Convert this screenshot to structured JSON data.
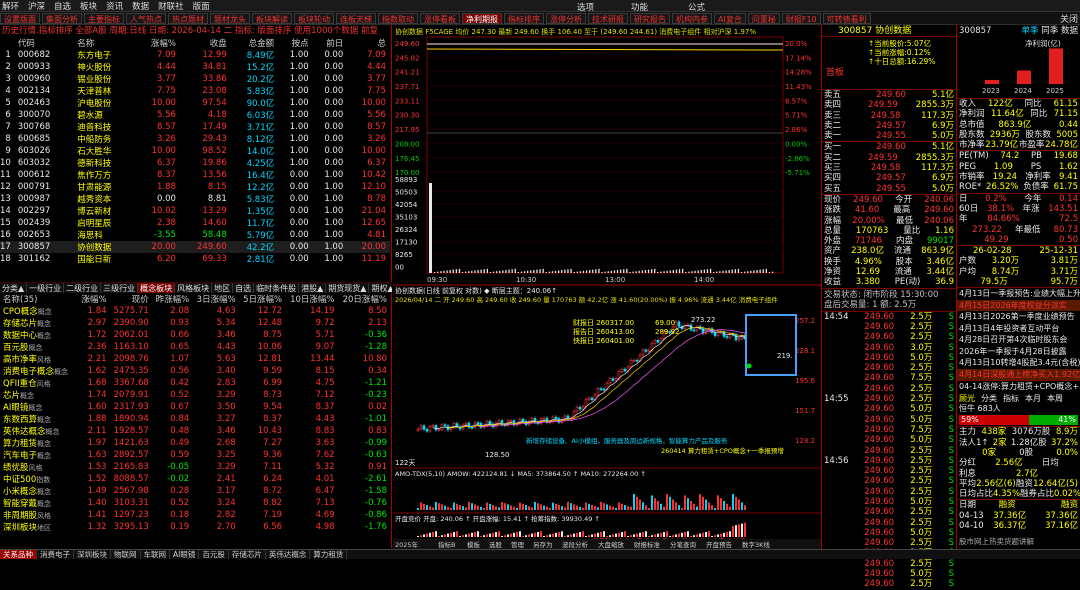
{
  "menubar": {
    "items": [
      "解环",
      "沪深",
      "自选",
      "板块",
      "资讯",
      "数据",
      "财联社",
      "版面"
    ],
    "center": "选项",
    "center2": "功能",
    "center3": "公式"
  },
  "toolbar": {
    "items": [
      "设置版面",
      "集面分析",
      "主要指标",
      "人气热点",
      "热点题材",
      "题材龙头",
      "板块解读",
      "板块轮动",
      "连板天梯",
      "指数取动",
      "涨停看板",
      "净利期报",
      "指标排序",
      "涨停分析",
      "技术研报",
      "研究报告",
      "机构内参",
      "AI复合",
      "问董秘",
      "财报F10",
      "可转债看利"
    ],
    "active": 11,
    "close": "关闭"
  },
  "left": {
    "title": "历史行情.指标排序 全部A股 周期:日线 日期: 2026-04-14 二 指标: 版面排序 使用1000个数据 前复",
    "headers": [
      "代码",
      "名称",
      "涨幅%",
      "收盘",
      "总金额",
      "按点",
      "前日",
      "总"
    ],
    "rows": [
      [
        "1",
        "000682",
        "东方电子",
        "7.09",
        "12.99",
        "8.49亿",
        "1.00",
        "0.00",
        "7.09"
      ],
      [
        "2",
        "000933",
        "神火股份",
        "4.44",
        "34.81",
        "15.2亿",
        "1.00",
        "0.00",
        "4.44"
      ],
      [
        "3",
        "000960",
        "锡业股份",
        "3.77",
        "33.86",
        "20.2亿",
        "1.00",
        "0.00",
        "3.77"
      ],
      [
        "4",
        "002134",
        "天津普林",
        "7.75",
        "23.08",
        "5.83亿",
        "1.00",
        "0.00",
        "7.75"
      ],
      [
        "5",
        "002463",
        "沪电股份",
        "10.00",
        "97.54",
        "90.0亿",
        "1.00",
        "0.00",
        "10.00"
      ],
      [
        "6",
        "300070",
        "碧水源",
        "5.56",
        "4.18",
        "6.03亿",
        "1.00",
        "0.00",
        "5.56"
      ],
      [
        "7",
        "300768",
        "迪普科技",
        "8.57",
        "17.49",
        "3.71亿",
        "1.00",
        "0.00",
        "8.57"
      ],
      [
        "8",
        "600685",
        "中船防务",
        "3.26",
        "29.43",
        "8.12亿",
        "1.00",
        "0.00",
        "3.26"
      ],
      [
        "9",
        "603026",
        "石大胜华",
        "10.00",
        "98.52",
        "14.0亿",
        "1.00",
        "0.00",
        "10.00"
      ],
      [
        "10",
        "603032",
        "德新科技",
        "6.37",
        "19.86",
        "4.25亿",
        "1.00",
        "0.00",
        "6.37"
      ],
      [
        "11",
        "000612",
        "焦作万方",
        "8.37",
        "13.56",
        "16.4亿",
        "0.00",
        "1.00",
        "10.42"
      ],
      [
        "12",
        "000791",
        "甘肃能源",
        "1.88",
        "8.15",
        "12.2亿",
        "0.00",
        "1.00",
        "12.10"
      ],
      [
        "13",
        "000987",
        "越秀资本",
        "0.00",
        "8.81",
        "5.83亿",
        "0.00",
        "1.00",
        "8.78"
      ],
      [
        "14",
        "002297",
        "博云新材",
        "10.02",
        "13.29",
        "1.35亿",
        "0.00",
        "1.00",
        "21.04"
      ],
      [
        "15",
        "002439",
        "启明星辰",
        "2.38",
        "14.60",
        "11.7亿",
        "0.00",
        "1.00",
        "12.65"
      ],
      [
        "16",
        "002653",
        "海思科",
        "-3.55",
        "58.48",
        "5.79亿",
        "0.00",
        "1.00",
        "4.81"
      ],
      [
        "17",
        "300857",
        "协创数据",
        "20.00",
        "249.60",
        "42.2亿",
        "0.00",
        "1.00",
        "20.00"
      ],
      [
        "18",
        "301162",
        "国能日新",
        "6.20",
        "69.33",
        "2.81亿",
        "0.00",
        "1.00",
        "11.19"
      ]
    ],
    "tabs": [
      "分类▲",
      "一级行业",
      "二级行业",
      "三级行业",
      "概念板块",
      "风格板块",
      "地区",
      "自选",
      "临时条件股",
      "港股▲",
      "期货现货▲",
      "期权▲"
    ],
    "tabs_active": 4,
    "headers2": [
      "名称(35)",
      "涨幅%",
      "现价",
      "昨涨幅%",
      "3日涨幅%",
      "5日涨幅%",
      "10日涨幅%",
      "20日涨幅%"
    ],
    "rows2": [
      [
        "CPO概念",
        "概念",
        "1.84",
        "5275.71",
        "2.08",
        "4.63",
        "12.72",
        "14.19",
        "8.50"
      ],
      [
        "存储芯片",
        "概念",
        "2.97",
        "2390.90",
        "0.93",
        "5.34",
        "12.48",
        "9.72",
        "2.13"
      ],
      [
        "数据中心",
        "概念",
        "1.72",
        "2062.01",
        "0.66",
        "3.46",
        "8.75",
        "5.71",
        "-0.36"
      ],
      [
        "百元股",
        "概念",
        "2.36",
        "1163.10",
        "0.65",
        "4.43",
        "10.06",
        "9.07",
        "-1.28"
      ],
      [
        "高市净率",
        "风格",
        "2.21",
        "2098.76",
        "1.07",
        "5.63",
        "12.81",
        "13.44",
        "10.80"
      ],
      [
        "消费电子概念",
        "概念",
        "1.62",
        "2475.35",
        "0.56",
        "3.40",
        "9.59",
        "8.15",
        "0.34"
      ],
      [
        "QFII重仓",
        "风格",
        "1.68",
        "3367.68",
        "0.42",
        "2.83",
        "6.99",
        "4.75",
        "-1.21"
      ],
      [
        "芯片",
        "概念",
        "1.74",
        "2079.91",
        "0.52",
        "3.29",
        "8.73",
        "7.12",
        "-0.23"
      ],
      [
        "AI眼镜",
        "概念",
        "1.60",
        "2317.93",
        "0.67",
        "3.50",
        "9.54",
        "8.37",
        "0.02"
      ],
      [
        "东数西算",
        "概念",
        "1.88",
        "1890.94",
        "0.84",
        "3.27",
        "8.37",
        "4.43",
        "-1.01"
      ],
      [
        "英伟达概念",
        "概念",
        "2.11",
        "1928.57",
        "0.48",
        "3.46",
        "10.43",
        "8.83",
        "0.83"
      ],
      [
        "算力租赁",
        "概念",
        "1.97",
        "1421.63",
        "0.49",
        "2.68",
        "7.27",
        "3.63",
        "-0.99"
      ],
      [
        "汽车电子",
        "概念",
        "1.63",
        "2892.57",
        "0.59",
        "3.25",
        "9.36",
        "7.62",
        "-0.63"
      ],
      [
        "绩优股",
        "风格",
        "1.53",
        "2165.83",
        "-0.05",
        "3.29",
        "7.11",
        "5.32",
        "0.91"
      ],
      [
        "中证500",
        "指数",
        "1.52",
        "8088.57",
        "-0.02",
        "2.41",
        "6.24",
        "4.01",
        "-2.61"
      ],
      [
        "小米概念",
        "概念",
        "1.49",
        "2567.98",
        "0.28",
        "3.17",
        "8.72",
        "6.47",
        "-1.58"
      ],
      [
        "智能穿戴",
        "概念",
        "1.40",
        "3103.31",
        "0.52",
        "3.24",
        "8.82",
        "7.13",
        "-0.76"
      ],
      [
        "非周期股",
        "风格",
        "1.41",
        "1297.23",
        "0.18",
        "2.82",
        "7.19",
        "4.69",
        "-0.86"
      ],
      [
        "深圳板块",
        "地区",
        "1.32",
        "3295.13",
        "0.19",
        "2.70",
        "6.56",
        "4.98",
        "-1.76"
      ]
    ]
  },
  "bottom_tabs": [
    "关系品种",
    "消费电子",
    "深圳板块",
    "物联网",
    "车联网",
    "AI眼镜",
    "百元股",
    "存储芯片",
    "英伟达概念",
    "算力租赁"
  ],
  "center": {
    "minute_header": "协创数据 F5CAGE 均价 247.30 最新 249.60 换手 106.40 至于 (249.60 244.61) 消费电子组件 相对沪深 1.97%",
    "price_labels": [
      "249.60",
      "245.82",
      "241.21",
      "237.71",
      "233.11",
      "230.30",
      "217.95",
      "208.00",
      "176.45",
      "170.00"
    ],
    "pct_labels": [
      "20.0%",
      "17.14%",
      "14.28%",
      "11.43%",
      "8.57%",
      "5.71%",
      "2.86%",
      "0.00%",
      "-2.86%",
      "-5.71%"
    ],
    "vol_labels": [
      "58893",
      "50503",
      "42054",
      "35103",
      "26324",
      "17130",
      "8265",
      "00"
    ],
    "time_labels": [
      "09:30",
      "10:30",
      "13:00",
      "14:00"
    ],
    "kline_header": "协创数据(日线 前复权 对数) ◆ 断层主题：240.06↑",
    "kline_sub": "2026/04/14 二 开 249.60 高 249.60 收 249.60 量 170763 额 42.2亿 涨 41.60(20.00%) 振 4.96% 流通 3.44亿 消费电子组件",
    "info_box": [
      "财报日 260317.00",
      "报告日 260413.00",
      "快报日 260401.00"
    ],
    "info_vals": [
      "69.00",
      "289.92",
      ""
    ],
    "kline_price": [
      "257.2",
      "228.1",
      "195.6",
      "151.7",
      "128.2"
    ],
    "annot_low": "128.50",
    "annot_high": "273.22",
    "annot_right": "219.",
    "days": "122天",
    "news": "新增存储设备、AI小模组，服务器及周边新规格，智能算力产品及服务",
    "news2": "260414 算力租赁+CPO概念+一季报预增",
    "macd_header": "AMO-TDX(5,10) AMOW: 422124.81 ↓ MA5: 373864.50 ↑ MA10: 272264.00 ↑",
    "ind_header": "开盘竞价 开盘: 240.06 ↑ 开盘涨幅: 15.41 ↑ 抢筹指数: 39930.49 ↑",
    "bottom_labels": [
      "2025年",
      "指标B",
      "模板",
      "选股",
      "管理",
      "另存为",
      "波段分析",
      "大盘缩放",
      "财报标准",
      "分笔查询",
      "开盘预告",
      "数字3K线"
    ],
    "bottom_info": "卖单数: 19.0 上市: 2089天 主力买入: 19.0 上市: 249天"
  },
  "quote": {
    "code": "300857",
    "name": "协创数据",
    "badge": "首板",
    "tags": [
      "↑当前股价:5.07亿",
      "↑当前涨幅:0.12%",
      "↑十日总额:16.29%"
    ],
    "sells": [
      [
        "卖五",
        "249.60",
        "5.1亿"
      ],
      [
        "卖四",
        "249.59",
        "2855.3万"
      ],
      [
        "卖三",
        "249.58",
        "117.3万"
      ],
      [
        "卖二",
        "249.57",
        "6.9万"
      ],
      [
        "卖一",
        "249.55",
        "5.0万"
      ]
    ],
    "buys": [
      [
        "买一",
        "249.60",
        "5.1亿"
      ],
      [
        "买二",
        "249.59",
        "2855.3万"
      ],
      [
        "买三",
        "249.58",
        "117.3万"
      ],
      [
        "买四",
        "249.57",
        "6.9万"
      ],
      [
        "买五",
        "249.55",
        "5.0万"
      ]
    ],
    "stats": [
      [
        "现价",
        "249.60",
        "今开",
        "240.06"
      ],
      [
        "涨跌",
        "41.60",
        "最高",
        "249.60"
      ],
      [
        "涨幅",
        "20.00%",
        "最低",
        "240.06"
      ],
      [
        "总量",
        "170763",
        "量比",
        "1.16"
      ],
      [
        "外盘",
        "71746",
        "内盘",
        "99017"
      ],
      [
        "资产",
        "238.0亿",
        "流通",
        "863.9亿"
      ],
      [
        "换手",
        "4.96%",
        "股本",
        "3.46亿"
      ],
      [
        "净资",
        "12.69",
        "流通",
        "3.44亿"
      ],
      [
        "收益",
        "3.380",
        "PE(动)",
        "36.9"
      ]
    ],
    "session": "交易状态: 闭市阶段 15:30:00",
    "after": "盘后交易量: 1 额: 2.5万",
    "ticks": [
      [
        "14:54",
        "249.60",
        "2.5万",
        "S"
      ],
      [
        "",
        "249.60",
        "2.5万",
        "S"
      ],
      [
        "",
        "249.60",
        "2.5万",
        "S"
      ],
      [
        "",
        "249.60",
        "3.0万",
        "S"
      ],
      [
        "",
        "249.60",
        "5.0万",
        "S"
      ],
      [
        "",
        "249.60",
        "2.5万",
        "S"
      ],
      [
        "",
        "249.60",
        "7.5万",
        "S"
      ],
      [
        "",
        "249.60",
        "2.5万",
        "S"
      ],
      [
        "14:55",
        "249.60",
        "2.5万",
        "S"
      ],
      [
        "",
        "249.60",
        "5.0万",
        "S"
      ],
      [
        "",
        "249.60",
        "5.0万",
        "S"
      ],
      [
        "",
        "249.60",
        "7.5万",
        "S"
      ],
      [
        "",
        "249.60",
        "5.0万",
        "S"
      ],
      [
        "",
        "249.60",
        "2.5万",
        "S"
      ],
      [
        "14:56",
        "249.60",
        "2.5万",
        "S"
      ],
      [
        "",
        "249.60",
        "2.5万",
        "S"
      ],
      [
        "",
        "249.60",
        "2.5万",
        "S"
      ],
      [
        "",
        "249.60",
        "2.5万",
        "S"
      ],
      [
        "",
        "249.60",
        "5.0万",
        "S"
      ],
      [
        "",
        "249.60",
        "2.5万",
        "S"
      ],
      [
        "",
        "249.60",
        "2.5万",
        "S"
      ],
      [
        "",
        "249.60",
        "5.0万",
        "S"
      ],
      [
        "",
        "249.60",
        "2.5万",
        "S"
      ],
      [
        "",
        "249.60",
        "2.5万",
        "S"
      ],
      [
        "",
        "249.60",
        "2.5万",
        "S"
      ],
      [
        "",
        "249.60",
        "5.0万",
        "S"
      ],
      [
        "",
        "249.60",
        "2.5万",
        "S"
      ],
      [
        "",
        "249.60",
        "2.5万",
        "S"
      ],
      [
        "",
        "249.60",
        "2.5万",
        "S"
      ],
      [
        "",
        "249.60",
        "5.0万",
        "S"
      ],
      [
        "",
        "249.60",
        "2.5万",
        "S"
      ],
      [
        "",
        "249.60",
        "2.5万",
        "S"
      ],
      [
        "",
        "249.60",
        "2.5万",
        "S"
      ],
      [
        "",
        "249.60",
        "5.0万",
        "S"
      ],
      [
        "",
        "249.60",
        "2.5万",
        "S"
      ],
      [
        "",
        "249.60",
        "2.5万",
        "S"
      ]
    ]
  },
  "f10": {
    "code": "300857",
    "tabs": [
      "单季",
      "同季",
      "数据"
    ],
    "chart_label": "净利润(亿)",
    "bars": [
      {
        "year": "2023",
        "value": 0.9
      },
      {
        "year": "2024",
        "value": 3.0
      },
      {
        "year": "2025",
        "value": 7.9
      }
    ],
    "metrics": [
      [
        "收入",
        "122亿",
        "同比",
        "61.15"
      ],
      [
        "净利润",
        "11.64亿",
        "同比",
        "71.15"
      ],
      [
        "总市值",
        "863.9亿",
        "",
        "0.44"
      ],
      [
        "股东数",
        "2936万",
        "股东数",
        "5005"
      ],
      [
        "市净率",
        "23.79亿",
        "市盈率",
        "24.78亿"
      ]
    ],
    "val": [
      [
        "PE(TM)",
        "74.2",
        "PB",
        "19.68"
      ],
      [
        "PEG",
        "1.09",
        "PS",
        "1.62"
      ],
      [
        "市销率",
        "19.24",
        "净利率",
        "9.41"
      ],
      [
        "ROE*",
        "26.52%",
        "负债率",
        "61.75"
      ]
    ],
    "holders": [
      [
        "日",
        "0.2%",
        "今年",
        "0.14"
      ],
      [
        "60日",
        "38.1%",
        "年涨",
        "143.51"
      ],
      [
        "年",
        "84.66%",
        "",
        "72.5"
      ],
      [
        "",
        "273.22",
        "年最低",
        "80.73"
      ],
      [
        "",
        "49.29",
        "",
        "0.50"
      ]
    ],
    "history": [
      [
        "",
        "26-02-28",
        "",
        "25-12-31"
      ],
      [
        "户数",
        "3.20万",
        "",
        "3.81万"
      ],
      [
        "户均",
        "8.74万",
        "",
        "3.71万"
      ],
      [
        "",
        "79.5万",
        "",
        "95.7万"
      ]
    ],
    "news": [
      "4月13日一季报预告:业绩大幅上升",
      "4月15日2026年度权益分派实",
      "4月13日2026第一季度业绩预告",
      "4月13日4年投资者互动平台",
      "4月28日召开第4次临时股东会",
      "2026年一季报于4月28日披露",
      "4月13日10转增4股配3.4元(含税)",
      "4月14日深股通上榜净买入1.92亿"
    ],
    "tag_line": "04-14涨停:算力租赁+CPO概念+...",
    "sub_tabs": [
      "顾光",
      "分类",
      "指标",
      "本月",
      "本周"
    ],
    "sentiment_label": "恒牛 683人",
    "bull_pct": "59%",
    "bear_pct": "41%",
    "flow": [
      [
        "主力",
        "438家",
        "3076万股",
        "8.9万"
      ],
      [
        "法人1↑",
        "2家",
        "1.28亿股",
        "37.2%"
      ],
      [
        "",
        "0家",
        "0股",
        "0.0%"
      ],
      [
        "分红",
        "2.56亿",
        "日均",
        ""
      ],
      [
        "利息",
        "2.7亿",
        ""
      ],
      [
        "平均",
        "2.56亿(6)",
        "融资",
        "12.64亿(5)"
      ],
      [
        "日均占比",
        "4.35%",
        "融券占比",
        "0.02%"
      ]
    ],
    "flow_dates": [
      [
        "日期",
        "融资",
        "",
        "融资"
      ],
      [
        "04-13",
        "37.36亿",
        "",
        "37.36亿"
      ],
      [
        "04-10",
        "36.37亿",
        "",
        "37.16亿"
      ]
    ],
    "watermark": "股市网上热卖货题讲解"
  }
}
